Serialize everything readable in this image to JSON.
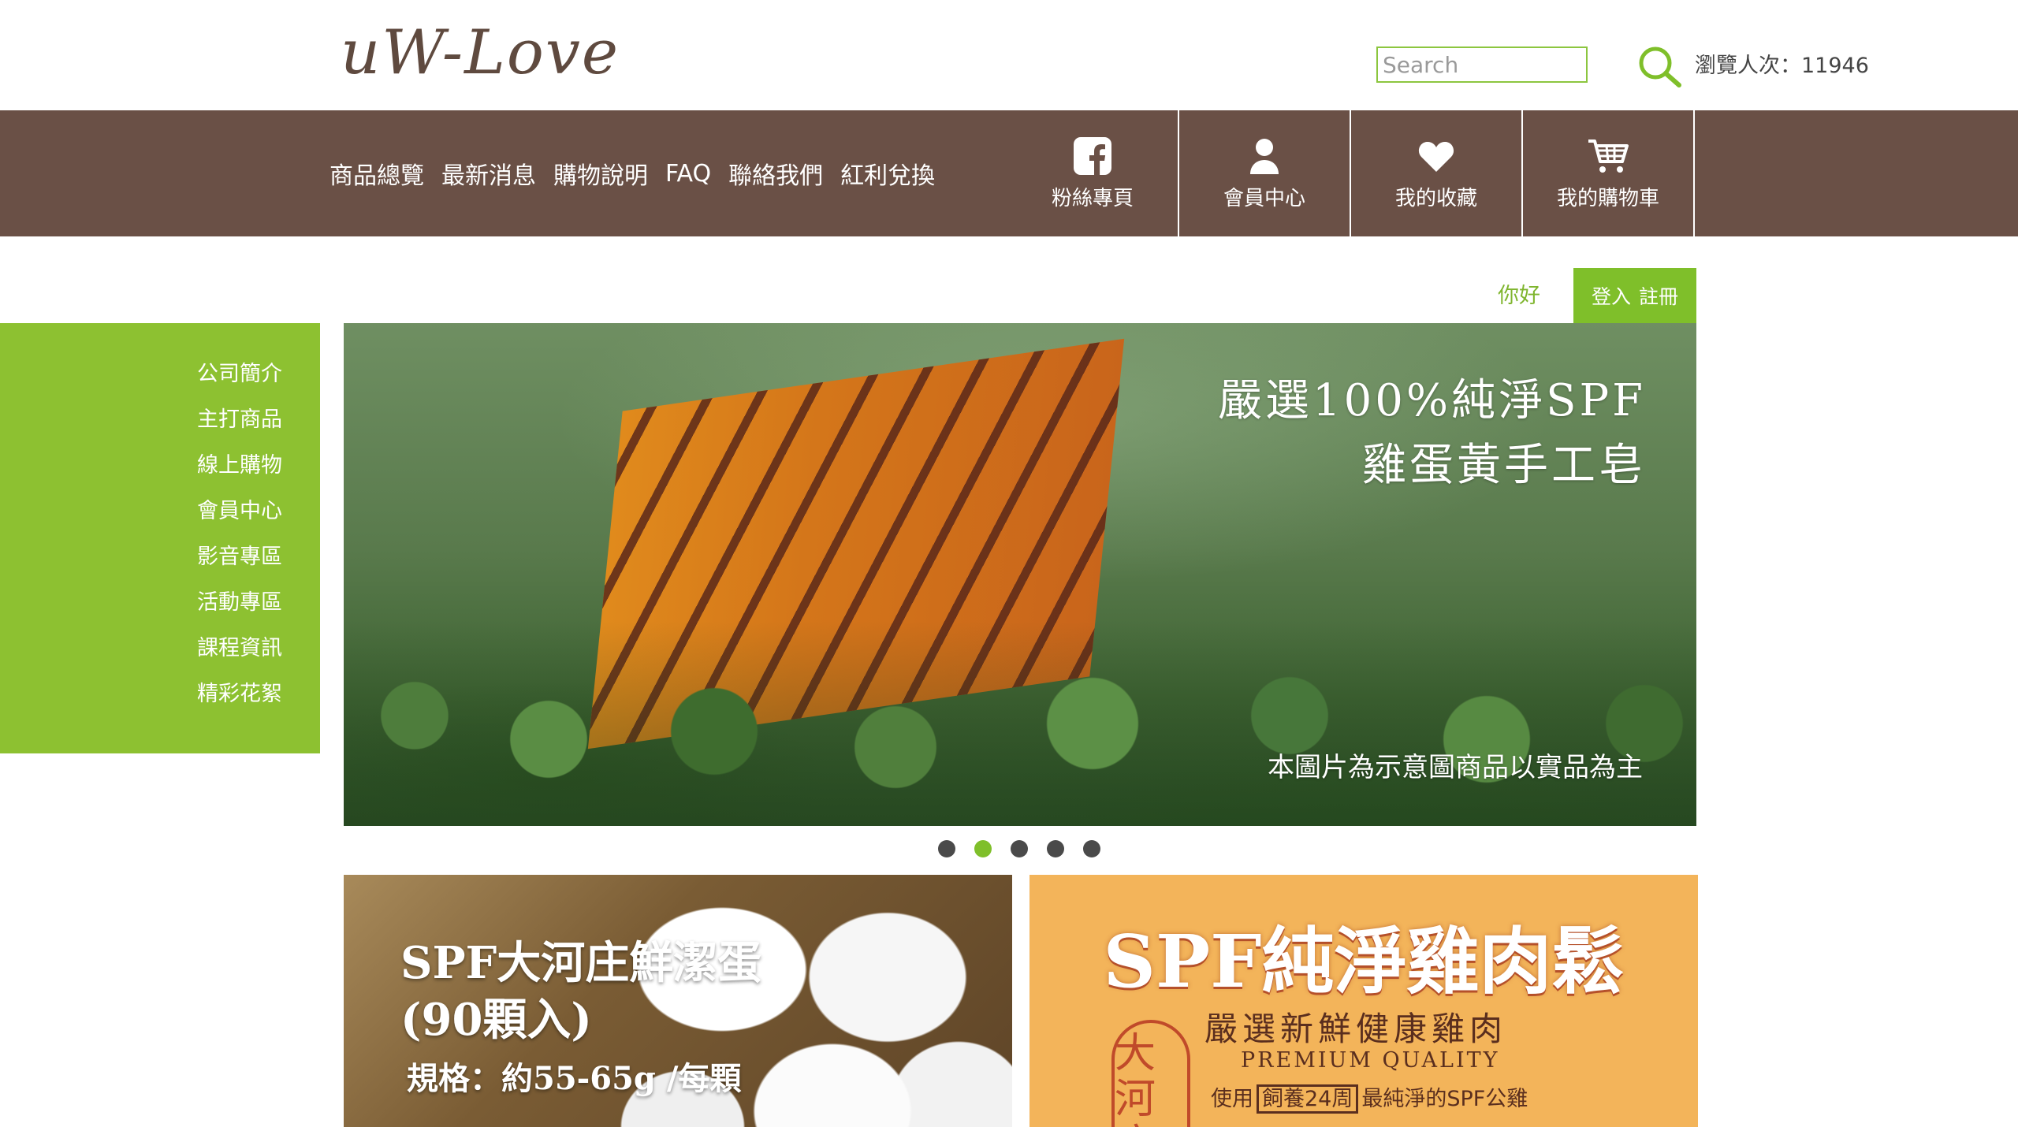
{
  "brand": {
    "logo_text": "uW-Love"
  },
  "header": {
    "search_placeholder": "Search",
    "visitor_label": "瀏覽人次：",
    "visitor_count": "11946"
  },
  "nav": {
    "menu": [
      "商品總覽",
      "最新消息",
      "購物說明",
      "FAQ",
      "聯絡我們",
      "紅利兌換"
    ],
    "quick_links": [
      {
        "label": "粉絲專頁",
        "icon": "facebook-icon"
      },
      {
        "label": "會員中心",
        "icon": "user-icon"
      },
      {
        "label": "我的收藏",
        "icon": "heart-icon"
      },
      {
        "label": "我的購物車",
        "icon": "cart-icon"
      }
    ]
  },
  "greeting": "你好",
  "auth": {
    "login": "登入",
    "register": "註冊"
  },
  "sidebar": {
    "items": [
      "公司簡介",
      "主打商品",
      "線上購物",
      "會員中心",
      "影音專區",
      "活動專區",
      "課程資訊",
      "精彩花絮"
    ]
  },
  "banner": {
    "title_line1": "嚴選100%純淨SPF",
    "title_line2": "雞蛋黃手工皂",
    "note": "本圖片為示意圖商品以實品為主"
  },
  "carousel": {
    "count": 5,
    "active_index": 1
  },
  "tiles": {
    "eggs": {
      "title_line1": "SPF大河庄鮮潔蛋",
      "title_line2": "(90顆入)",
      "spec": "規格：約55-65g /每顆"
    },
    "floss": {
      "headline": "SPF純淨雞肉鬆",
      "sub1": "嚴選新鮮健康雞肉",
      "sub2": "PREMIUM QUALITY",
      "sub3_pre": "使用",
      "sub3_boxed": "飼養24周",
      "sub3_post": "最純淨的SPF公雞",
      "seal_text": "大河庄"
    }
  },
  "colors": {
    "nav_brown": "#6a5046",
    "accent_green": "#8dc131",
    "logo_brown": "#5f4a3f",
    "floss_orange": "#f3b45a"
  }
}
